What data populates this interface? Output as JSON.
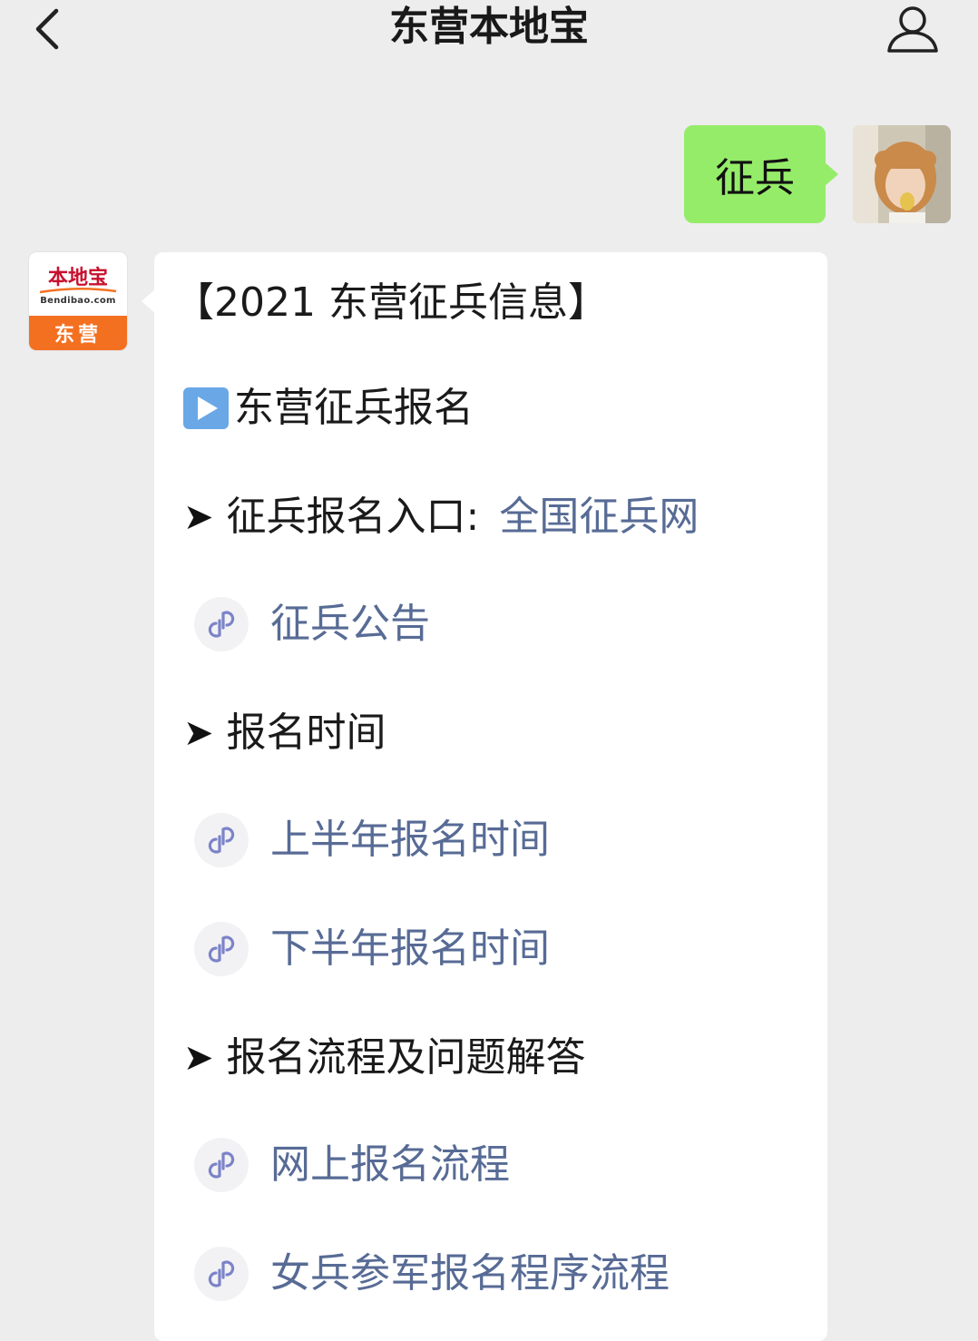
{
  "header": {
    "title": "东营本地宝"
  },
  "outgoing_message": {
    "text": "征兵"
  },
  "bot_avatar": {
    "logo_text": "本地宝",
    "logo_domain": "Bendibao.com",
    "city": "东营"
  },
  "reply": {
    "heading": "【2021 东营征兵信息】",
    "section_title": "东营征兵报名",
    "arrow_glyph": "➤",
    "items": [
      {
        "label": "征兵报名入口:",
        "link": "全国征兵网"
      },
      {
        "mini_program": "征兵公告"
      },
      {
        "label": "报名时间"
      },
      {
        "mini_program": "上半年报名时间"
      },
      {
        "mini_program": "下半年报名时间"
      },
      {
        "label": "报名流程及问题解答"
      },
      {
        "mini_program": "网上报名流程"
      },
      {
        "mini_program": "女兵参军报名程序流程"
      }
    ]
  },
  "colors": {
    "background": "#ededed",
    "my_bubble": "#95ec69",
    "link": "#576b95",
    "brand_orange": "#f37021",
    "brand_red": "#c8102e"
  },
  "icons": [
    "back-icon",
    "user-icon",
    "play-icon",
    "mini-program-icon"
  ]
}
